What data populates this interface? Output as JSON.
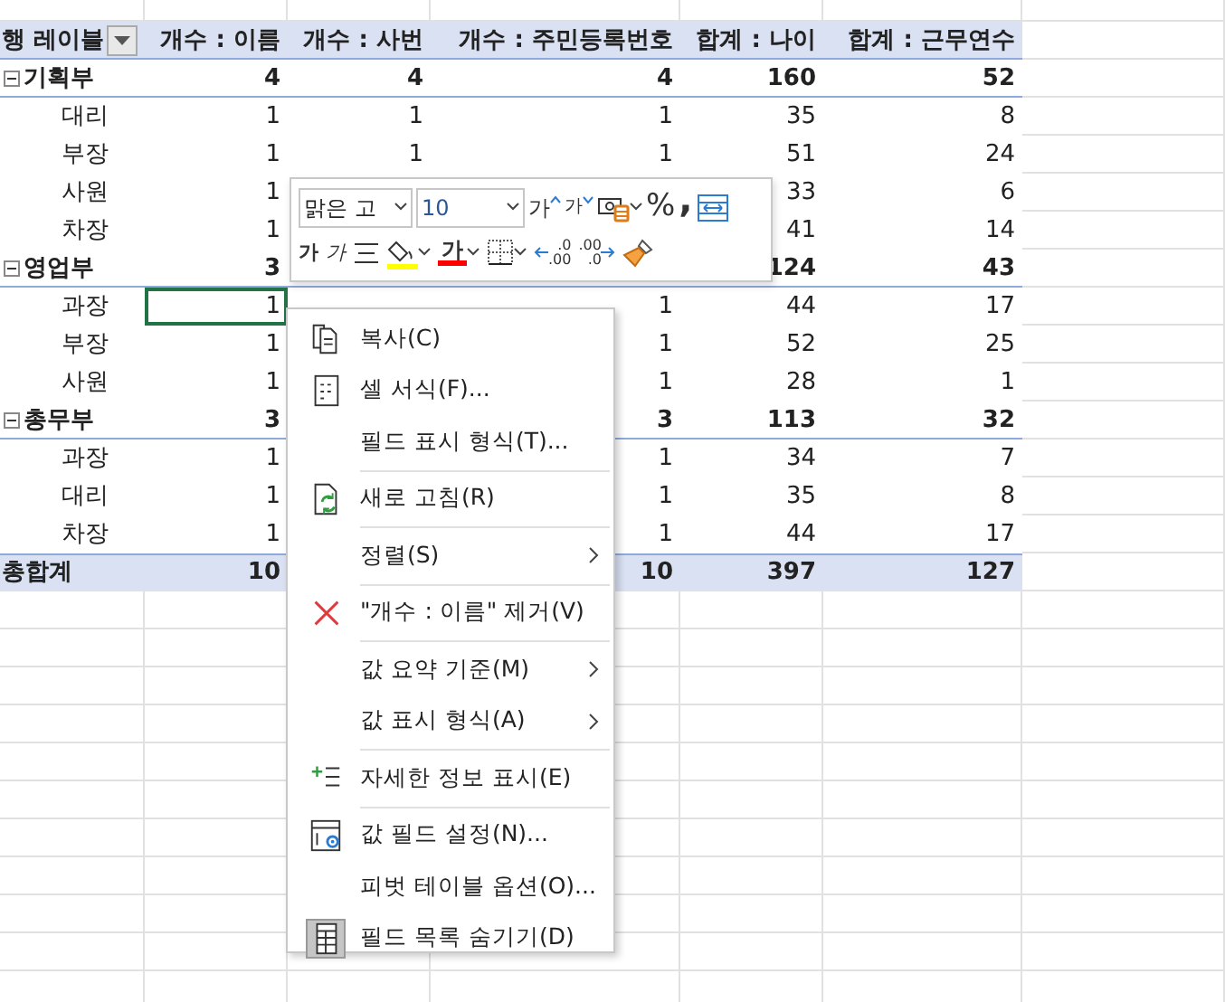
{
  "pivot": {
    "headers": [
      {
        "label": "행 레이블",
        "has_filter": true
      },
      {
        "label": "개수 : 이름"
      },
      {
        "label": "개수 : 사번"
      },
      {
        "label": "개수 : 주민등록번호"
      },
      {
        "label": "합계 : 나이"
      },
      {
        "label": "합계 : 근무연수"
      }
    ],
    "rows": [
      {
        "kind": "group",
        "label": "기획부",
        "expanded": true,
        "cells": [
          {
            "text": "4",
            "selected": false
          },
          {
            "text": "4",
            "selected": false
          },
          {
            "text": "4",
            "selected": false
          },
          {
            "text": "160",
            "selected": false
          },
          {
            "text": "52",
            "selected": false
          }
        ]
      },
      {
        "kind": "item",
        "label": "대리",
        "cells": [
          {
            "text": "1",
            "selected": false
          },
          {
            "text": "1",
            "selected": false
          },
          {
            "text": "1",
            "selected": false
          },
          {
            "text": "35",
            "selected": false
          },
          {
            "text": "8",
            "selected": false
          }
        ]
      },
      {
        "kind": "item",
        "label": "부장",
        "cells": [
          {
            "text": "1",
            "selected": false
          },
          {
            "text": "1",
            "selected": false
          },
          {
            "text": "1",
            "selected": false
          },
          {
            "text": "51",
            "selected": false
          },
          {
            "text": "24",
            "selected": false
          }
        ]
      },
      {
        "kind": "item",
        "label": "사원",
        "cells": [
          {
            "text": "1",
            "selected": false
          },
          null,
          null,
          {
            "text": "33",
            "selected": false
          },
          {
            "text": "6",
            "selected": false
          }
        ]
      },
      {
        "kind": "item",
        "label": "차장",
        "cells": [
          {
            "text": "1",
            "selected": false
          },
          null,
          null,
          {
            "text": "41",
            "selected": false
          },
          {
            "text": "14",
            "selected": false
          }
        ]
      },
      {
        "kind": "group",
        "label": "영업부",
        "expanded": true,
        "cells": [
          {
            "text": "3",
            "selected": false
          },
          null,
          null,
          {
            "text": "124",
            "selected": false
          },
          {
            "text": "43",
            "selected": false
          }
        ]
      },
      {
        "kind": "item",
        "label": "과장",
        "cells": [
          {
            "text": "1",
            "selected": true
          },
          null,
          {
            "text": "1",
            "selected": false
          },
          {
            "text": "44",
            "selected": false
          },
          {
            "text": "17",
            "selected": false
          }
        ]
      },
      {
        "kind": "item",
        "label": "부장",
        "cells": [
          {
            "text": "1",
            "selected": false
          },
          null,
          {
            "text": "1",
            "selected": false
          },
          {
            "text": "52",
            "selected": false
          },
          {
            "text": "25",
            "selected": false
          }
        ]
      },
      {
        "kind": "item",
        "label": "사원",
        "cells": [
          {
            "text": "1",
            "selected": false
          },
          null,
          {
            "text": "1",
            "selected": false
          },
          {
            "text": "28",
            "selected": false
          },
          {
            "text": "1",
            "selected": false
          }
        ]
      },
      {
        "kind": "group",
        "label": "총무부",
        "expanded": true,
        "cells": [
          {
            "text": "3",
            "selected": false
          },
          null,
          {
            "text": "3",
            "selected": false
          },
          {
            "text": "113",
            "selected": false
          },
          {
            "text": "32",
            "selected": false
          }
        ]
      },
      {
        "kind": "item",
        "label": "과장",
        "cells": [
          {
            "text": "1",
            "selected": false
          },
          null,
          {
            "text": "1",
            "selected": false
          },
          {
            "text": "34",
            "selected": false
          },
          {
            "text": "7",
            "selected": false
          }
        ]
      },
      {
        "kind": "item",
        "label": "대리",
        "cells": [
          {
            "text": "1",
            "selected": false
          },
          null,
          {
            "text": "1",
            "selected": false
          },
          {
            "text": "35",
            "selected": false
          },
          {
            "text": "8",
            "selected": false
          }
        ]
      },
      {
        "kind": "item",
        "label": "차장",
        "cells": [
          {
            "text": "1",
            "selected": false
          },
          null,
          {
            "text": "1",
            "selected": false
          },
          {
            "text": "44",
            "selected": false
          },
          {
            "text": "17",
            "selected": false
          }
        ]
      },
      {
        "kind": "total",
        "label": "총합계",
        "cells": [
          {
            "text": "10",
            "selected": false
          },
          null,
          {
            "text": "10",
            "selected": false
          },
          {
            "text": "397",
            "selected": false
          },
          {
            "text": "127",
            "selected": false
          }
        ]
      }
    ]
  },
  "mini_toolbar": {
    "font": {
      "value": "맑은 고"
    },
    "size": {
      "value": "10"
    },
    "row_1": [
      {
        "kind": "grow",
        "label": "가"
      },
      {
        "kind": "shrink",
        "label": "가"
      },
      {
        "kind": "accounting"
      },
      {
        "kind": "percent",
        "label": "%"
      },
      {
        "kind": "comma",
        "label": ","
      },
      {
        "kind": "merge"
      }
    ],
    "row_2": [
      {
        "kind": "bold",
        "label": "가"
      },
      {
        "kind": "italic",
        "label": "가"
      },
      {
        "kind": "align"
      },
      {
        "kind": "fill"
      },
      {
        "kind": "fontcolor",
        "label": "가"
      },
      {
        "kind": "border"
      },
      {
        "kind": "dec-decimal",
        "lines": [
          ".0",
          ".00"
        ]
      },
      {
        "kind": "inc-decimal",
        "lines": [
          ".00",
          ".0"
        ]
      },
      {
        "kind": "painter"
      }
    ]
  },
  "context_menu": [
    {
      "kind": "copy",
      "label": "복사(C)"
    },
    {
      "kind": "format",
      "label": "셀 서식(F)..."
    },
    {
      "kind": "plain",
      "label": "필드 표시 형식(T)..."
    },
    {
      "kind": "separator"
    },
    {
      "kind": "refresh",
      "label": "새로 고침(R)"
    },
    {
      "kind": "separator"
    },
    {
      "kind": "plain",
      "label": "정렬(S)",
      "submenu": true
    },
    {
      "kind": "separator"
    },
    {
      "kind": "remove",
      "label": "\"개수 : 이름\" 제거(V)"
    },
    {
      "kind": "separator"
    },
    {
      "kind": "plain",
      "label": "값 요약 기준(M)",
      "submenu": true
    },
    {
      "kind": "plain",
      "label": "값 표시 형식(A)",
      "submenu": true
    },
    {
      "kind": "separator"
    },
    {
      "kind": "details",
      "label": "자세한 정보 표시(E)"
    },
    {
      "kind": "separator"
    },
    {
      "kind": "settings",
      "label": "값 필드 설정(N)..."
    },
    {
      "kind": "plain",
      "label": "피벗 테이블 옵션(O)..."
    },
    {
      "kind": "fieldlist",
      "label": "필드 목록 숨기기(D)",
      "checked": true
    }
  ]
}
